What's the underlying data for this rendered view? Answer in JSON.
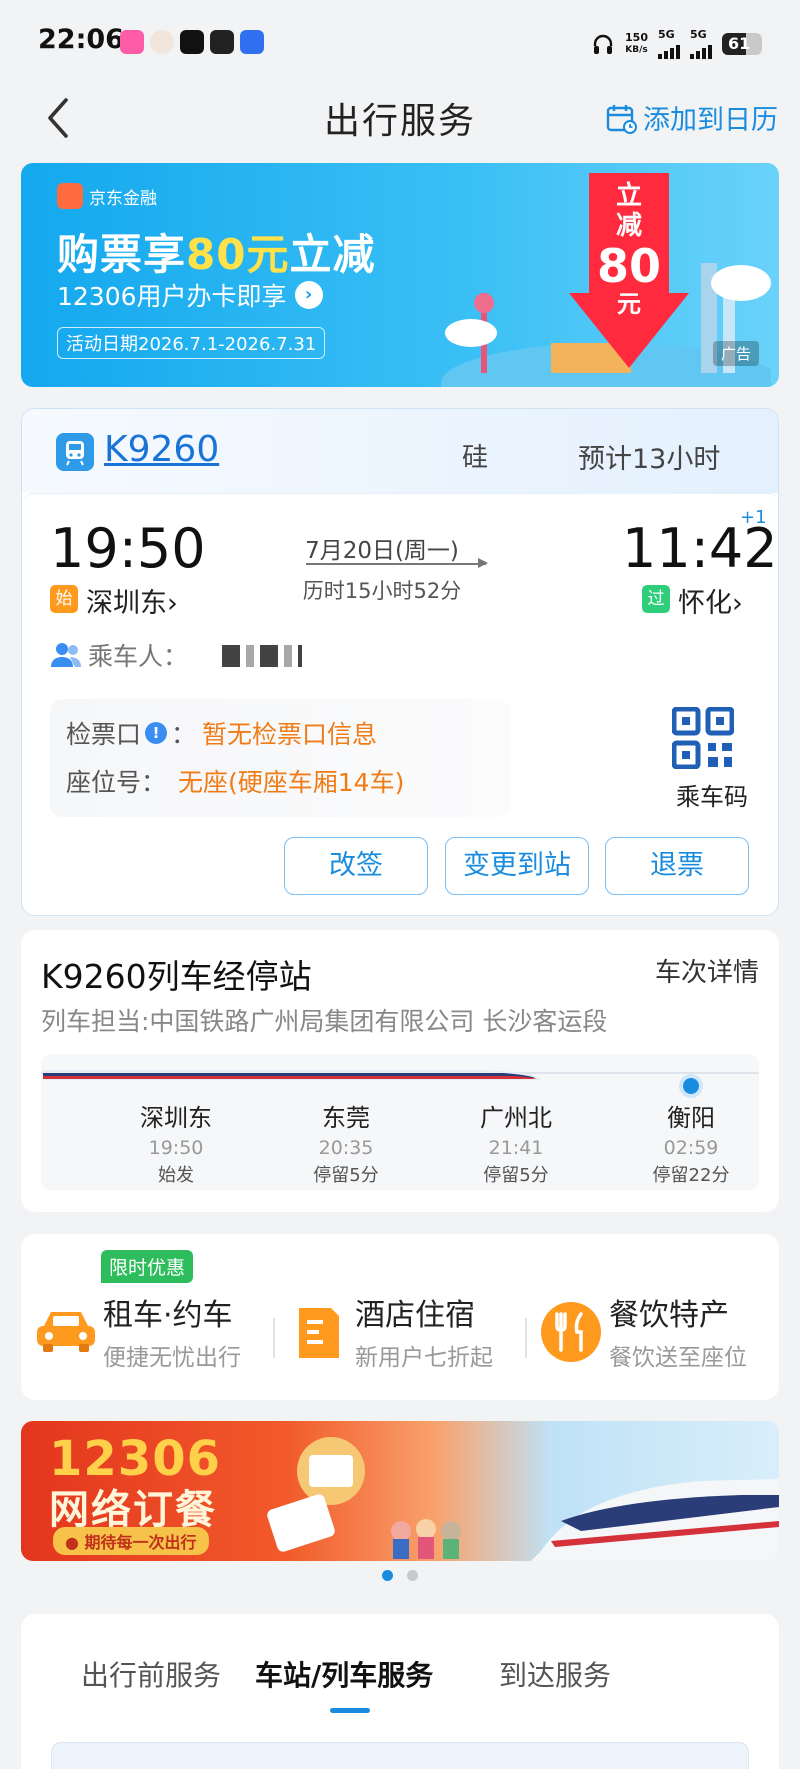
{
  "status_bar": {
    "time": "22:06",
    "net_speed_value": "150",
    "net_speed_unit": "KB/s",
    "signal1": "5G",
    "signal2": "5G",
    "battery": "61",
    "battery_level": 0.61
  },
  "header": {
    "title": "出行服务",
    "calendar_label": "添加到日历"
  },
  "banner_top": {
    "brand": "京东金融",
    "headline_pre": "购票享",
    "headline_highlight": "80元",
    "headline_post": "立减",
    "subline": "12306用户办卡即享",
    "date_range": "活动日期2026.7.1-2026.7.31",
    "badge_line1": "立",
    "badge_line2": "减",
    "badge_amount": "80",
    "badge_unit": "元",
    "ad_tag": "广告"
  },
  "ticket": {
    "train_number": "K9260",
    "seat_fragment": "硅",
    "eta": "预计13小时",
    "departure_time": "19:50",
    "arrival_time": "11:42",
    "plus_days": "+1",
    "date": "7月20日(周一)",
    "duration": "历时15小时52分",
    "departure_tag": "始",
    "departure_station": "深圳东›",
    "arrival_tag": "过",
    "arrival_station": "怀化›",
    "passenger_label": "乘车人：",
    "gate_label": "检票口",
    "gate_colon": "：",
    "gate_value": "暂无检票口信息",
    "seat_label": "座位号：",
    "seat_value": "无座(硬座车厢14车)",
    "qr_label": "乘车码",
    "buttons": [
      "改签",
      "变更到站",
      "退票"
    ]
  },
  "stops": {
    "title": "K9260列车经停站",
    "detail_link": "车次详情",
    "operator": "列车担当:中国铁路广州局集团有限公司 长沙客运段",
    "items": [
      {
        "name": "深圳东",
        "time": "19:50",
        "dwell": "始发"
      },
      {
        "name": "东莞",
        "time": "20:35",
        "dwell": "停留5分"
      },
      {
        "name": "广州北",
        "time": "21:41",
        "dwell": "停留5分"
      },
      {
        "name": "衡阳",
        "time": "02:59",
        "dwell": "停留22分"
      }
    ]
  },
  "services": {
    "promo_tag": "限时优惠",
    "items": [
      {
        "title": "租车·约车",
        "subtitle": "便捷无忧出行",
        "icon": "car-icon"
      },
      {
        "title": "酒店住宿",
        "subtitle": "新用户七折起",
        "icon": "hotel-icon"
      },
      {
        "title": "餐饮特产",
        "subtitle": "餐饮送至座位",
        "icon": "dining-icon"
      }
    ]
  },
  "banner_food": {
    "line1": "12306",
    "line2": "网络订餐",
    "pill": "● 期待每一次出行"
  },
  "carousel": {
    "active_index": 0,
    "count": 2
  },
  "bottom_tabs": {
    "tabs": [
      "出行前服务",
      "车站/列车服务",
      "到达服务"
    ],
    "active": 1
  },
  "colors": {
    "accent": "#1a8ce0",
    "warning_text": "#f07c16",
    "promo_green": "#2ebd5c"
  }
}
